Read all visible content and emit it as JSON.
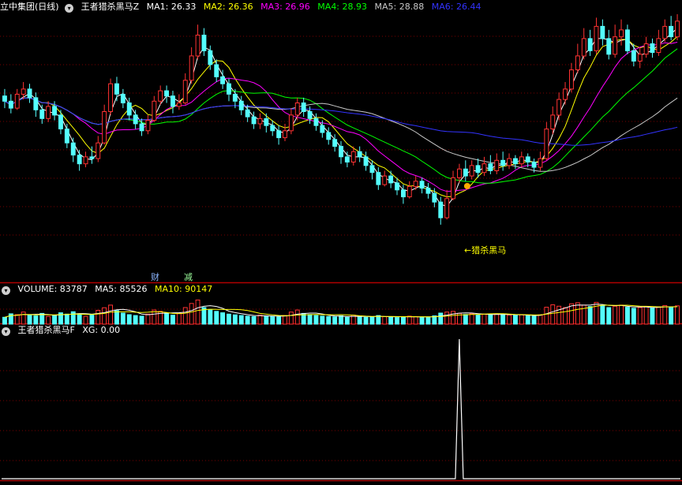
{
  "colors": {
    "up": "#ff3232",
    "down": "#54ffff",
    "grid": "#7a0000",
    "sep": "#b00000",
    "ma1": "#ffffff",
    "ma2": "#ffff00",
    "ma3": "#ff00ff",
    "ma4": "#00ff00",
    "ma5": "#c8c8c8",
    "ma6": "#3333ff",
    "vma10": "#ffff00",
    "xg": "#ffffff"
  },
  "header": {
    "stock_name": "立中集团(日线)",
    "indicator": "王者猎杀黑马Z",
    "ma1": "MA1: 26.33",
    "ma2": "MA2: 26.36",
    "ma3": "MA3: 26.96",
    "ma4": "MA4: 28.93",
    "ma5": "MA5: 28.88",
    "ma6": "MA6: 26.44",
    "arrow_icon": "chevron-down-icon"
  },
  "volume_header": {
    "label": "VOLUME: 83787",
    "ma5": "MA5: 85526",
    "ma10": "MA10: 90147"
  },
  "xg_header": {
    "label": "王者猎杀黑马F",
    "xg": "XG: 0.00"
  },
  "markers": {
    "cai": "财",
    "jian": "减",
    "signal": "←猎杀黑马"
  },
  "chart_data": {
    "type": "candlestick",
    "series": [
      {
        "name": "MA1"
      },
      {
        "name": "MA2"
      },
      {
        "name": "MA3"
      },
      {
        "name": "MA4"
      },
      {
        "name": "MA5"
      },
      {
        "name": "MA6"
      }
    ],
    "price_range": [
      20.6,
      34.2
    ],
    "candles": [
      [
        29.5,
        29.2,
        29.9,
        28.8
      ],
      [
        29.2,
        28.8,
        29.6,
        28.5
      ],
      [
        28.8,
        29.6,
        29.9,
        28.7
      ],
      [
        29.6,
        29.9,
        30.3,
        29.3
      ],
      [
        29.9,
        29.4,
        30.2,
        29.1
      ],
      [
        29.4,
        28.7,
        29.7,
        28.3
      ],
      [
        28.7,
        28.2,
        29.0,
        27.9
      ],
      [
        28.2,
        28.9,
        29.2,
        28.0
      ],
      [
        28.9,
        28.4,
        29.2,
        28.1
      ],
      [
        28.4,
        27.6,
        28.7,
        27.3
      ],
      [
        27.6,
        26.8,
        27.9,
        26.5
      ],
      [
        26.8,
        26.1,
        27.1,
        25.7
      ],
      [
        26.1,
        25.6,
        26.4,
        25.2
      ],
      [
        25.6,
        26.0,
        26.3,
        25.4
      ],
      [
        26.0,
        25.9,
        26.6,
        25.6
      ],
      [
        25.9,
        26.8,
        27.2,
        25.7
      ],
      [
        26.8,
        28.6,
        29.0,
        26.7
      ],
      [
        28.6,
        30.2,
        30.5,
        28.4
      ],
      [
        30.2,
        29.6,
        30.6,
        29.2
      ],
      [
        29.6,
        29.1,
        29.9,
        28.8
      ],
      [
        29.1,
        28.4,
        29.4,
        28.1
      ],
      [
        28.4,
        27.9,
        28.7,
        27.6
      ],
      [
        27.9,
        27.5,
        28.2,
        27.2
      ],
      [
        27.5,
        28.1,
        28.4,
        27.3
      ],
      [
        28.1,
        29.2,
        29.5,
        28.0
      ],
      [
        29.2,
        29.8,
        30.1,
        29.0
      ],
      [
        29.8,
        29.5,
        30.1,
        29.1
      ],
      [
        29.5,
        28.9,
        29.8,
        28.5
      ],
      [
        28.9,
        29.1,
        29.6,
        28.7
      ],
      [
        29.1,
        30.4,
        30.8,
        29.0
      ],
      [
        30.4,
        31.8,
        32.3,
        30.2
      ],
      [
        31.8,
        33.0,
        33.6,
        31.6
      ],
      [
        33.0,
        32.1,
        33.4,
        31.8
      ],
      [
        32.1,
        31.3,
        32.4,
        31.0
      ],
      [
        31.3,
        30.6,
        31.6,
        30.3
      ],
      [
        30.6,
        30.2,
        31.0,
        29.9
      ],
      [
        30.2,
        29.6,
        30.5,
        29.2
      ],
      [
        29.6,
        29.2,
        29.9,
        28.8
      ],
      [
        29.2,
        28.7,
        29.5,
        28.4
      ],
      [
        28.7,
        28.3,
        29.0,
        28.0
      ],
      [
        28.3,
        27.9,
        28.6,
        27.6
      ],
      [
        27.9,
        28.2,
        28.5,
        27.6
      ],
      [
        28.2,
        27.8,
        28.5,
        27.4
      ],
      [
        27.8,
        27.5,
        28.1,
        27.2
      ],
      [
        27.5,
        27.1,
        27.8,
        26.7
      ],
      [
        27.1,
        27.5,
        27.9,
        26.9
      ],
      [
        27.5,
        28.4,
        28.8,
        27.3
      ],
      [
        28.4,
        29.1,
        29.4,
        28.1
      ],
      [
        29.1,
        28.6,
        29.4,
        28.3
      ],
      [
        28.6,
        28.2,
        28.9,
        27.9
      ],
      [
        28.2,
        27.8,
        28.5,
        27.5
      ],
      [
        27.8,
        27.4,
        28.1,
        27.1
      ],
      [
        27.4,
        27.0,
        27.7,
        26.7
      ],
      [
        27.0,
        26.6,
        27.3,
        26.3
      ],
      [
        26.6,
        26.0,
        26.9,
        25.6
      ],
      [
        26.0,
        25.7,
        26.3,
        25.4
      ],
      [
        25.7,
        26.3,
        26.6,
        25.5
      ],
      [
        26.3,
        26.0,
        26.6,
        25.7
      ],
      [
        26.0,
        25.5,
        26.3,
        25.2
      ],
      [
        25.5,
        25.1,
        25.8,
        24.7
      ],
      [
        25.1,
        24.4,
        25.4,
        24.1
      ],
      [
        24.4,
        24.9,
        25.2,
        24.3
      ],
      [
        24.9,
        24.5,
        25.2,
        24.2
      ],
      [
        24.5,
        24.1,
        24.8,
        23.8
      ],
      [
        24.1,
        23.7,
        24.4,
        23.3
      ],
      [
        23.7,
        24.3,
        24.6,
        23.6
      ],
      [
        24.3,
        24.6,
        24.9,
        24.1
      ],
      [
        24.6,
        24.2,
        24.8,
        23.9
      ],
      [
        24.2,
        23.9,
        24.5,
        23.6
      ],
      [
        23.9,
        23.4,
        24.2,
        23.1
      ],
      [
        23.4,
        22.5,
        23.7,
        22.1
      ],
      [
        22.5,
        23.6,
        24.1,
        22.4
      ],
      [
        23.6,
        24.8,
        25.2,
        23.5
      ],
      [
        24.8,
        25.3,
        25.6,
        24.5
      ],
      [
        25.3,
        24.9,
        25.8,
        24.6
      ],
      [
        24.9,
        25.5,
        25.8,
        24.7
      ],
      [
        25.5,
        25.1,
        25.9,
        24.8
      ],
      [
        25.1,
        25.6,
        26.0,
        24.9
      ],
      [
        25.6,
        25.2,
        26.1,
        25.0
      ],
      [
        25.2,
        25.8,
        26.2,
        25.0
      ],
      [
        25.8,
        25.5,
        26.3,
        25.2
      ],
      [
        25.5,
        25.9,
        26.2,
        25.3
      ],
      [
        25.9,
        25.6,
        26.1,
        25.3
      ],
      [
        25.6,
        26.0,
        26.3,
        25.4
      ],
      [
        26.0,
        25.7,
        26.2,
        25.4
      ],
      [
        25.7,
        25.4,
        25.9,
        25.1
      ],
      [
        25.4,
        25.9,
        26.3,
        25.2
      ],
      [
        25.9,
        27.6,
        28.0,
        25.8
      ],
      [
        27.6,
        28.4,
        28.9,
        27.3
      ],
      [
        28.4,
        29.3,
        29.7,
        28.1
      ],
      [
        29.3,
        29.9,
        30.3,
        29.0
      ],
      [
        29.9,
        31.0,
        31.4,
        29.7
      ],
      [
        31.0,
        31.8,
        32.5,
        30.8
      ],
      [
        31.8,
        32.8,
        33.4,
        31.6
      ],
      [
        32.8,
        32.1,
        33.3,
        31.8
      ],
      [
        32.1,
        33.5,
        34.0,
        31.9
      ],
      [
        33.5,
        32.8,
        33.9,
        32.4
      ],
      [
        32.8,
        31.9,
        33.3,
        31.6
      ],
      [
        31.9,
        32.9,
        33.6,
        31.7
      ],
      [
        32.9,
        33.3,
        33.9,
        32.4
      ],
      [
        33.3,
        32.1,
        33.6,
        31.9
      ],
      [
        32.1,
        31.5,
        32.5,
        31.2
      ],
      [
        31.5,
        31.9,
        32.3,
        31.1
      ],
      [
        31.9,
        32.5,
        32.9,
        31.7
      ],
      [
        32.5,
        32.0,
        32.8,
        31.7
      ],
      [
        32.0,
        32.8,
        33.3,
        31.8
      ],
      [
        32.8,
        33.5,
        33.9,
        32.6
      ],
      [
        33.5,
        32.9,
        34.1,
        32.7
      ],
      [
        32.9,
        33.8,
        34.2,
        32.7
      ]
    ],
    "volume": [
      40,
      60,
      55,
      70,
      52,
      48,
      62,
      45,
      50,
      66,
      58,
      72,
      60,
      45,
      52,
      80,
      95,
      110,
      78,
      64,
      55,
      50,
      46,
      58,
      82,
      74,
      60,
      52,
      64,
      96,
      120,
      140,
      96,
      82,
      74,
      66,
      58,
      54,
      50,
      46,
      44,
      52,
      48,
      44,
      42,
      50,
      70,
      82,
      62,
      56,
      50,
      46,
      44,
      42,
      48,
      40,
      52,
      44,
      40,
      42,
      50,
      44,
      40,
      38,
      42,
      46,
      44,
      40,
      38,
      48,
      64,
      70,
      74,
      62,
      56,
      60,
      52,
      58,
      54,
      60,
      56,
      52,
      50,
      54,
      50,
      46,
      54,
      98,
      112,
      104,
      96,
      118,
      124,
      110,
      102,
      126,
      108,
      96,
      104,
      110,
      98,
      92,
      96,
      102,
      94,
      100,
      108,
      98,
      106
    ],
    "volume_range": [
      0,
      160
    ],
    "xg_spike_at_index": 73,
    "cai_index": 40,
    "jian_index": 48
  }
}
